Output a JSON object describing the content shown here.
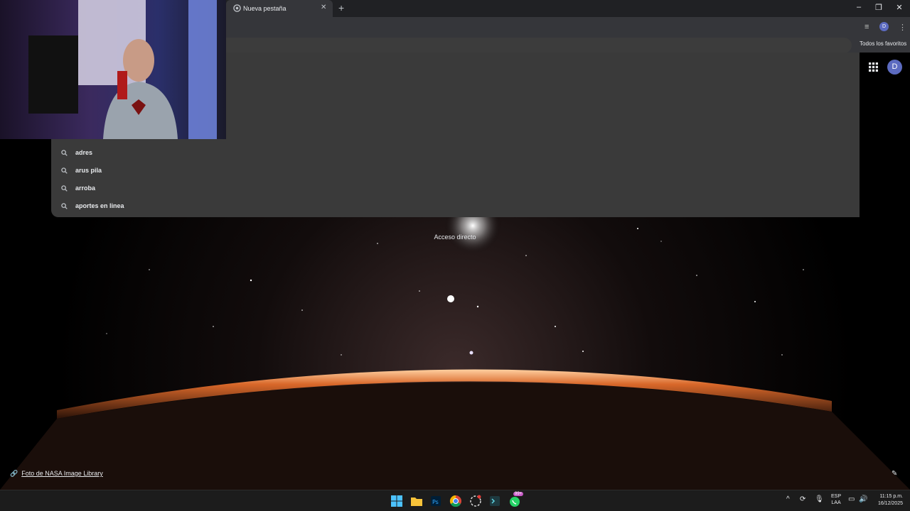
{
  "browser": {
    "tab_title": "Nueva pestaña",
    "bookmarks_label": "Todos los favoritos",
    "profile_initial": "D"
  },
  "suggestions": [
    "adres",
    "arus pila",
    "arroba",
    "aportes en linea"
  ],
  "newtab": {
    "shortcut_label": "Acceso directo",
    "photo_credit": "Foto de NASA Image Library",
    "profile_initial": "D"
  },
  "taskbar": {
    "language": "ESP",
    "layout": "LAA",
    "time": "11:15 p.m.",
    "date": "16/12/2025",
    "whatsapp_badge": "99+"
  },
  "colors": {
    "chrome_dark": "#202124",
    "chrome_toolbar": "#35363a",
    "panel": "#3a3a3a",
    "accent_avatar": "#5c6bc0"
  }
}
